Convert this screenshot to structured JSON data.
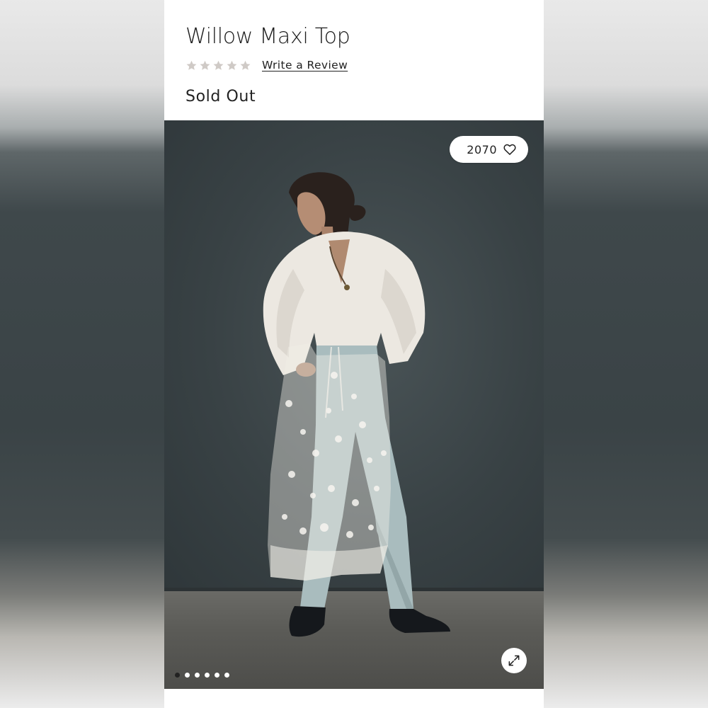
{
  "product": {
    "title": "Willow Maxi Top",
    "rating": {
      "value": 0,
      "max": 5,
      "empty_color": "#cfcac6"
    },
    "review_link_label": "Write a Review",
    "status": "Sold Out"
  },
  "gallery": {
    "favorite_count": "2070",
    "favorite_icon": "heart-icon",
    "expand_icon": "expand-icon",
    "slide_count": 6,
    "active_slide": 0
  },
  "colors": {
    "text": "#222222",
    "background": "#ffffff"
  }
}
